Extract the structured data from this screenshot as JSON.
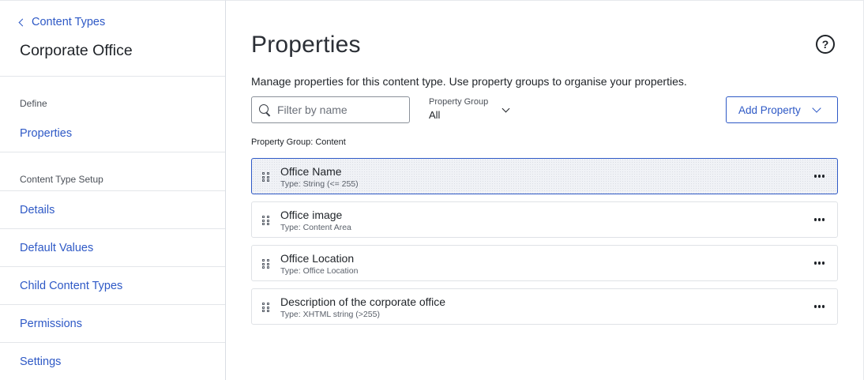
{
  "sidebar": {
    "back_label": "Content Types",
    "title": "Corporate Office",
    "section_define": "Define",
    "item_properties": "Properties",
    "section_setup": "Content Type Setup",
    "items": [
      {
        "label": "Details"
      },
      {
        "label": "Default Values"
      },
      {
        "label": "Child Content Types"
      },
      {
        "label": "Permissions"
      },
      {
        "label": "Settings"
      }
    ]
  },
  "main": {
    "title": "Properties",
    "help_glyph": "?",
    "description": "Manage properties for this content type. Use property groups to organise your properties.",
    "filter": {
      "placeholder": "Filter by name",
      "value": ""
    },
    "property_group": {
      "label": "Property Group",
      "value": "All"
    },
    "add_button": "Add Property",
    "group_label": "Property Group: Content",
    "properties": [
      {
        "name": "Office Name",
        "type": "Type: String (<= 255)",
        "selected": true
      },
      {
        "name": "Office image",
        "type": "Type: Content Area",
        "selected": false
      },
      {
        "name": "Office Location",
        "type": "Type: Office Location",
        "selected": false
      },
      {
        "name": "Description of the corporate office",
        "type": "Type: XHTML string (>255)",
        "selected": false
      }
    ]
  },
  "colors": {
    "accent": "#2e59c6",
    "border": "#dfe2e6",
    "text": "#1f2328"
  },
  "icons": [
    "chevron-left-icon",
    "help-icon",
    "search-icon",
    "chevron-down-icon",
    "drag-handle-icon",
    "more-options-icon"
  ]
}
